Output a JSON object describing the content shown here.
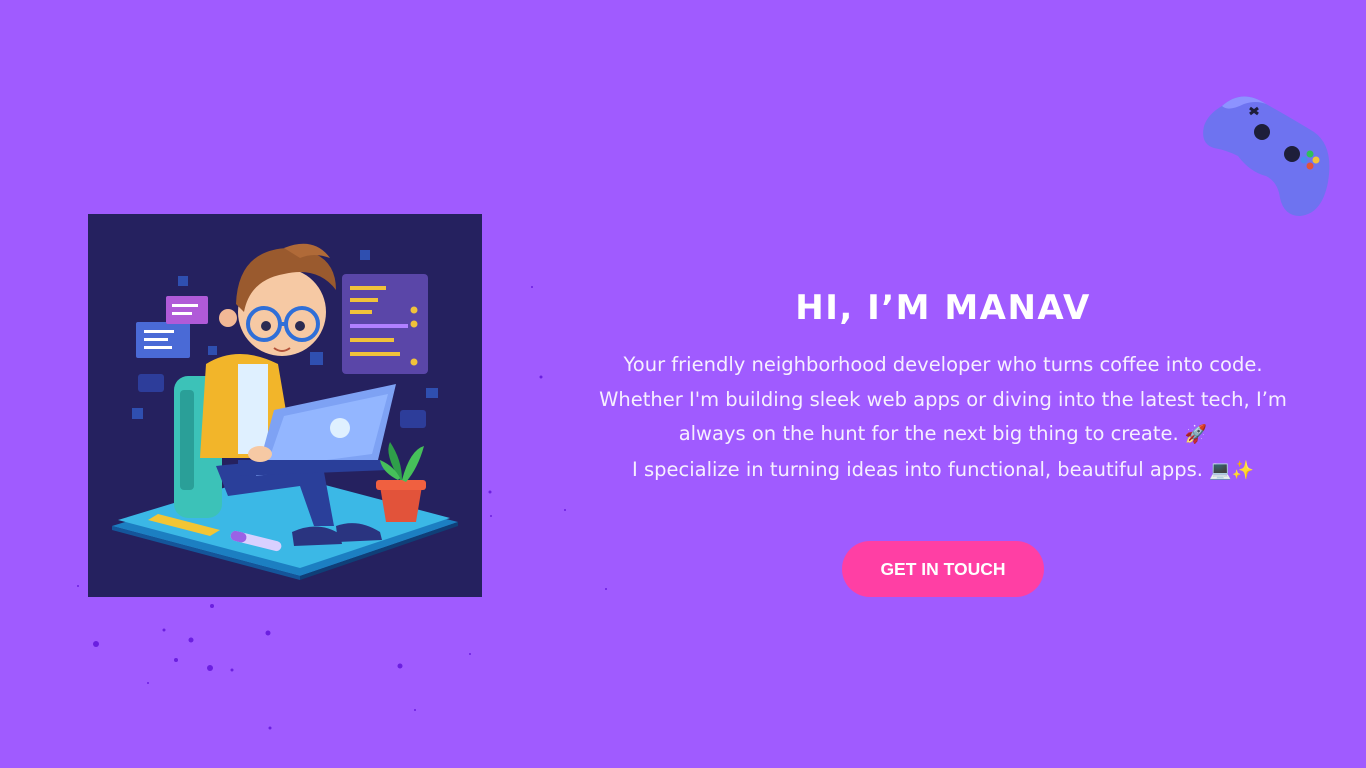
{
  "hero": {
    "illustration_icon": "developer-with-laptop-illustration",
    "title": "HI, I’M MANAV",
    "description_lines": [
      "Your friendly neighborhood developer who turns coffee into code.",
      "Whether I'm building sleek web apps or diving into the latest tech, I’m",
      "always on the hunt for the next big thing to create.",
      "I specialize in turning ideas into functional, beautiful apps."
    ],
    "emoji_rocket": "🚀",
    "emoji_laptop_sparkles": "💻✨",
    "cta_label": "GET IN TOUCH"
  },
  "decor": {
    "gamepad_icon": "gamepad-icon"
  },
  "colors": {
    "background": "#a05bff",
    "accent_button": "#ff3fa4",
    "illustration_bg": "#25215f",
    "gamepad": "#6e73f0"
  }
}
